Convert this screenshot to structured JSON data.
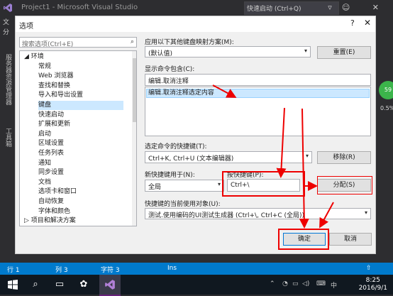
{
  "vs": {
    "title": "Project1 - Microsoft Visual Studio",
    "quick_launch": "快速启动 (Ctrl+Q)",
    "menu_partial_1": "文",
    "menu_partial_2": "分",
    "left_panel_1": "服务器资源管理器",
    "left_panel_2": "工具箱",
    "right_badge": "59",
    "right_pct": "0.5%"
  },
  "status": {
    "row": "行 1",
    "col": "列 3",
    "char": "字符 3",
    "mode": "Ins"
  },
  "taskbar": {
    "time": "8:25",
    "date": "2016/9/1",
    "ime": "中"
  },
  "dialog": {
    "title": "选项",
    "help": "?",
    "close": "✕",
    "search_placeholder": "搜索选项(Ctrl+E)",
    "tree": [
      {
        "label": "◢  环境",
        "indent": 0
      },
      {
        "label": "常规",
        "indent": 1
      },
      {
        "label": "Web 浏览器",
        "indent": 1
      },
      {
        "label": "查找和替换",
        "indent": 1
      },
      {
        "label": "导入和导出设置",
        "indent": 1
      },
      {
        "label": "键盘",
        "indent": 1,
        "selected": true
      },
      {
        "label": "快速启动",
        "indent": 1
      },
      {
        "label": "扩展和更新",
        "indent": 1
      },
      {
        "label": "启动",
        "indent": 1
      },
      {
        "label": "区域设置",
        "indent": 1
      },
      {
        "label": "任务列表",
        "indent": 1
      },
      {
        "label": "通知",
        "indent": 1
      },
      {
        "label": "同步设置",
        "indent": 1
      },
      {
        "label": "文档",
        "indent": 1
      },
      {
        "label": "选项卡和窗口",
        "indent": 1
      },
      {
        "label": "自动恢复",
        "indent": 1
      },
      {
        "label": "字体和颜色",
        "indent": 1
      },
      {
        "label": "▷  项目和解决方案",
        "indent": 0
      }
    ],
    "mapping_label": "应用以下其他键盘映射方案(M):",
    "mapping_value": "(默认值)",
    "reset_button": "重置(E)",
    "contains_label": "显示命令包含(C):",
    "contains_value": "编辑.取消注释",
    "command_item": "编辑.取消注释选定内容",
    "shortcuts_label": "选定命令的快捷键(T):",
    "shortcuts_value": "Ctrl+K, Ctrl+U (文本编辑器)",
    "remove_button": "移除(R)",
    "use_in_label": "新快捷键用于(N):",
    "use_in_value": "全局",
    "press_keys_label": "按快捷键(P):",
    "press_keys_value": "Ctrl+\\",
    "assign_button": "分配(S)",
    "used_by_label": "快捷键的当前使用对象(U):",
    "used_by_value": "测试.使用编码的UI测试生成器 (Ctrl+\\, Ctrl+C (全局))",
    "ok_button": "确定",
    "cancel_button": "取消"
  },
  "colors": {
    "accent": "#007acc",
    "annotation": "#e00000",
    "selection": "#cce8ff"
  }
}
